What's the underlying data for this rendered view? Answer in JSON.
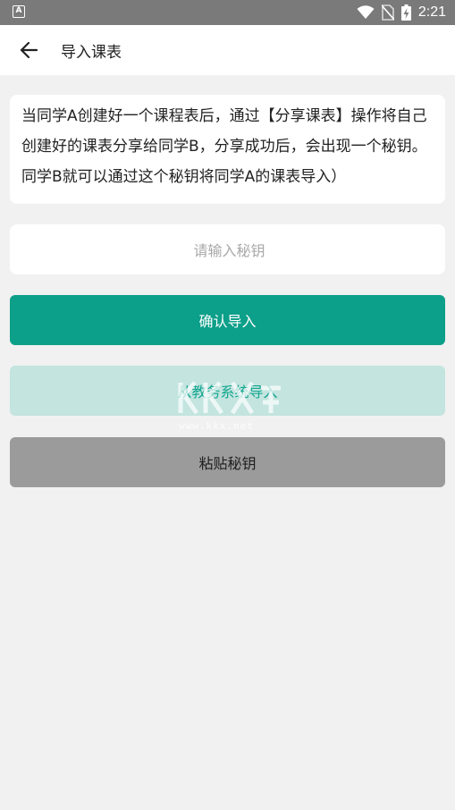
{
  "status_bar": {
    "time": "2:21",
    "left_icon_letter": "A",
    "icons": [
      "wifi-icon",
      "no-sim-icon",
      "battery-charging-icon"
    ]
  },
  "toolbar": {
    "title": "导入课表",
    "back_icon": "arrow-left-icon"
  },
  "description": "当同学A创建好一个课程表后，通过【分享课表】操作将自己创建好的课表分享给同学B，分享成功后，会出现一个秘钥。同学B就可以通过这个秘钥将同学A的课表导入）",
  "key_input": {
    "placeholder": "请输入秘钥",
    "value": ""
  },
  "buttons": {
    "confirm": "确认导入",
    "system_import": "从教务系统导入",
    "paste": "粘贴秘钥"
  },
  "watermark": {
    "url": "www.kkx.net"
  },
  "colors": {
    "status_bar": "#7a7a7a",
    "accent": "#0c9f89",
    "accent_light": "#c3e4df",
    "paste_button": "#9b9b9b",
    "background": "#f1f1f1"
  }
}
